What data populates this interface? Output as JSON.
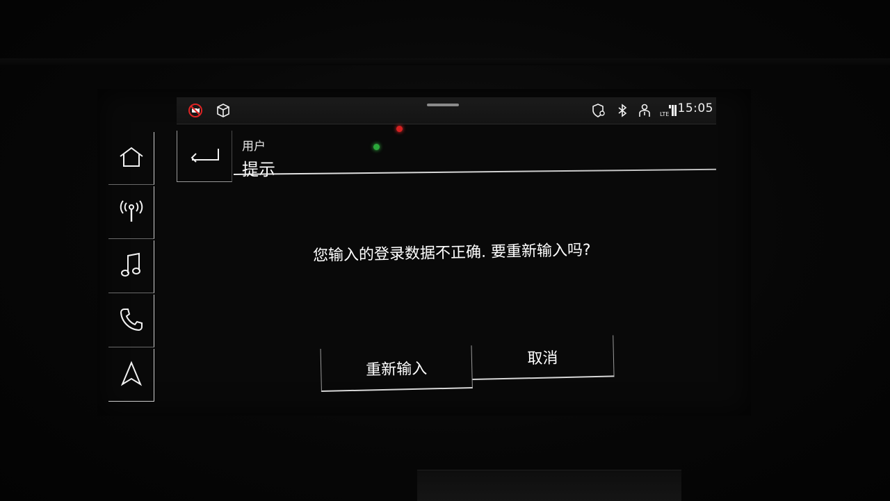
{
  "status_bar": {
    "time": "15:05",
    "icons": [
      "no-camera-icon",
      "cube-icon",
      "shield-location-icon",
      "bluetooth-icon",
      "user-icon",
      "lte-signal-icon"
    ],
    "lte_label": "LTE"
  },
  "sidebar": {
    "items": [
      {
        "name": "home",
        "icon": "home-icon"
      },
      {
        "name": "radio",
        "icon": "radio-antenna-icon"
      },
      {
        "name": "media",
        "icon": "music-note-icon"
      },
      {
        "name": "phone",
        "icon": "phone-icon"
      },
      {
        "name": "navigation",
        "icon": "navigation-arrow-icon"
      }
    ]
  },
  "header": {
    "subtitle": "用户",
    "title": "提示"
  },
  "dialog": {
    "message": "您输入的登录数据不正确. 要重新输入吗?",
    "retry_label": "重新输入",
    "cancel_label": "取消"
  },
  "colors": {
    "accent_red": "#e02424",
    "foreground": "#f2f2f2",
    "background": "#090909"
  }
}
